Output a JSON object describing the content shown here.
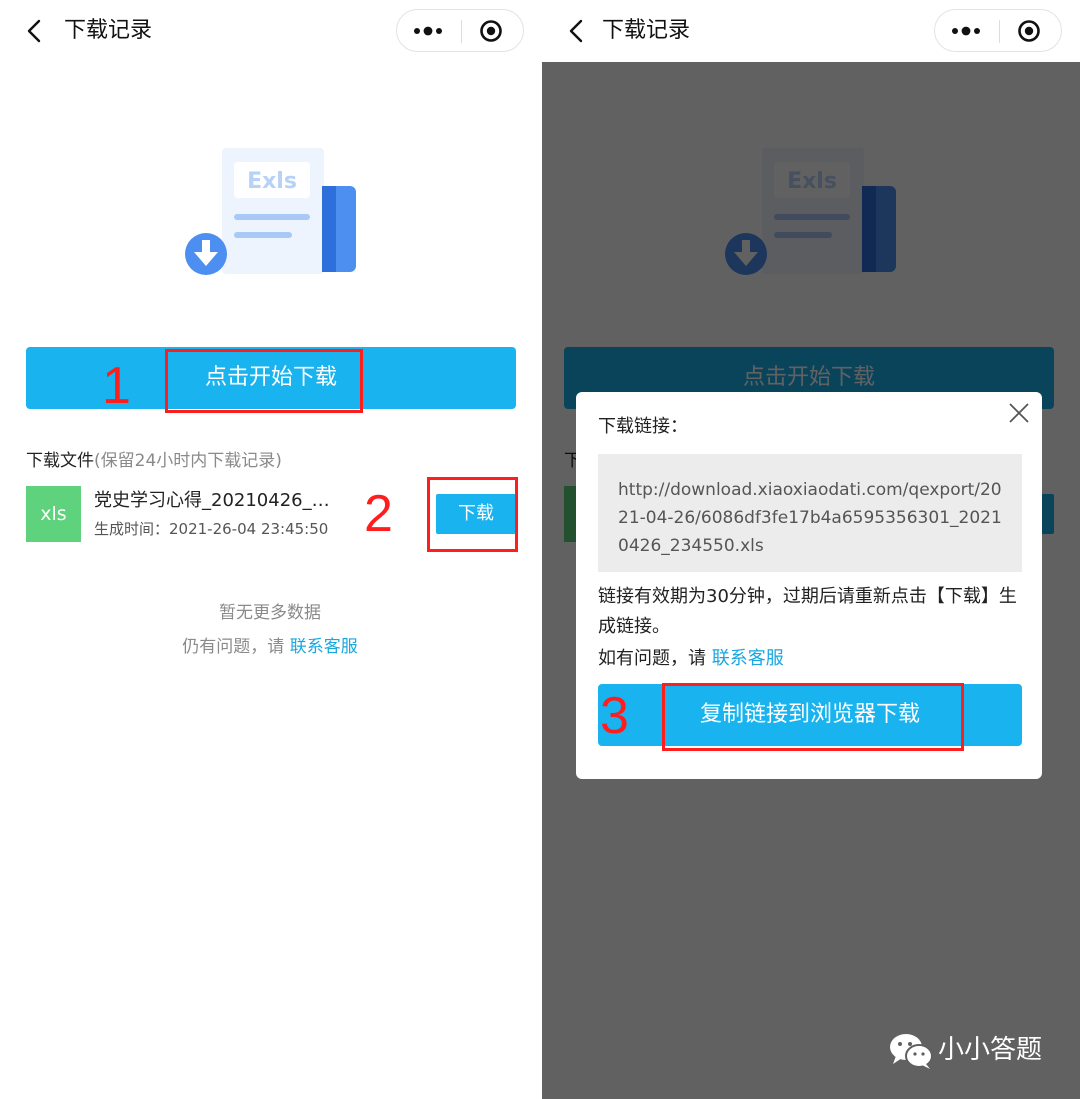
{
  "nav": {
    "title": "下载记录"
  },
  "illustration": {
    "label": "Exls"
  },
  "start_button": {
    "label": "点击开始下载"
  },
  "files_section": {
    "title": "下载文件",
    "note": "(保留24小时内下载记录)"
  },
  "file": {
    "type": "xls",
    "name": "党史学习心得_20210426_…",
    "time": "生成时间：2021-26-04 23:45:50",
    "download_label": "下载"
  },
  "footer": {
    "no_more": "暂无更多数据",
    "help_prefix": "仍有问题，请",
    "help_link": "联系客服"
  },
  "steps": {
    "one": "1",
    "two": "2",
    "three": "3"
  },
  "modal": {
    "title": "下载链接：",
    "url": "http://download.xiaoxiaodati.com/qexport/2021-04-26/6086df3fe17b4a6595356301_20210426_234550.xls",
    "note": "链接有效期为30分钟，过期后请重新点击【下载】生成链接。",
    "help_prefix": "如有问题，请",
    "help_link": "联系客服",
    "copy_button": "复制链接到浏览器下载"
  },
  "watermark": {
    "text": "小小答题"
  },
  "colors": {
    "primary": "#19b4ef",
    "file_icon": "#5ed27c",
    "link": "#1aa7df",
    "annotation": "#ff1e1e",
    "mask": "#5f5f5f"
  },
  "icons": [
    "back-icon",
    "more-icon",
    "close-circle-icon",
    "download-arrow-icon",
    "close-icon",
    "wechat-icon"
  ]
}
